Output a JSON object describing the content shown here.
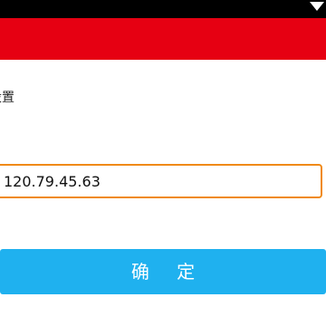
{
  "status_bar": {
    "icons": [
      "wifi-icon"
    ],
    "color": "#000000"
  },
  "title_bar": {
    "color": "#e60012"
  },
  "settings": {
    "section_label": "设置",
    "ip_value": "120.79.45.63",
    "field_border_color": "#f08a16"
  },
  "actions": {
    "confirm_label": "确 定",
    "confirm_color": "#1fb1ef"
  }
}
